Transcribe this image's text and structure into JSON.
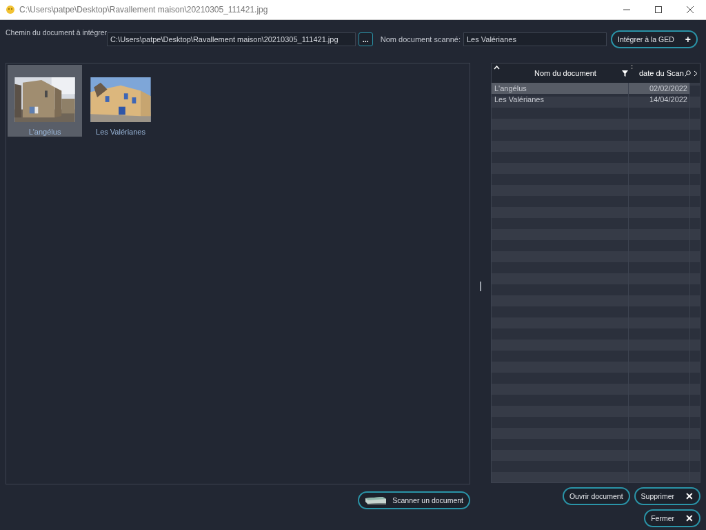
{
  "window": {
    "title": "C:\\Users\\patpe\\Desktop\\Ravallement maison\\20210305_111421.jpg"
  },
  "path_field": {
    "label": "Chemin du document à intégrer",
    "value": "C:\\Users\\patpe\\Desktop\\Ravallement maison\\20210305_111421.jpg",
    "browse_button": "..."
  },
  "name_field": {
    "label": "Nom document scanné:",
    "value": "Les Valérianes"
  },
  "integrate_button": {
    "label": "Intégrer à la GED",
    "icon": "+"
  },
  "thumbnails": [
    {
      "caption": "L'angélus",
      "selected": true,
      "kind": "picture"
    },
    {
      "caption": "Les Valérianes",
      "selected": false,
      "kind": "picture"
    }
  ],
  "table": {
    "columns": [
      "Nom du document",
      "date du Scan"
    ],
    "rows": [
      {
        "name": "L'angélus",
        "date": "02/02/2022",
        "selected": true
      },
      {
        "name": "Les Valérianes",
        "date": "14/04/2022",
        "selected": false
      }
    ]
  },
  "scan_button": {
    "label": "Scanner un document"
  },
  "open_button": {
    "label": "Ouvrir document"
  },
  "delete_button": {
    "label": "Supprimer",
    "icon": "✕"
  },
  "close_button": {
    "label": "Fermer",
    "icon": "✕"
  }
}
